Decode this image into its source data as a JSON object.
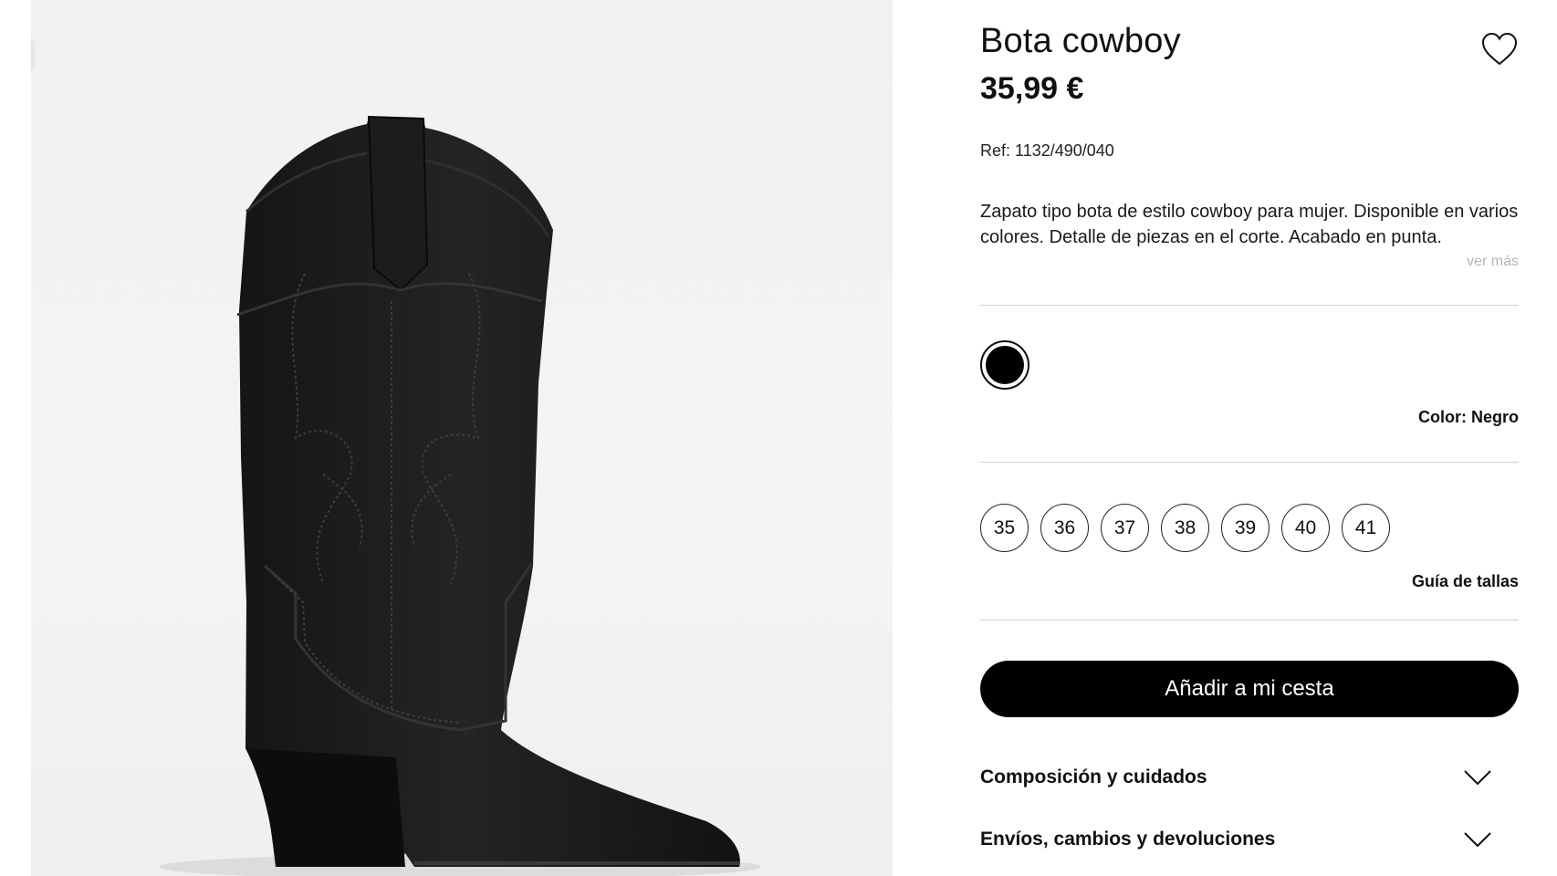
{
  "product": {
    "title": "Bota cowboy",
    "price": "35,99 €",
    "ref": "Ref: 1132/490/040",
    "description": "Zapato tipo bota de estilo cowboy para mujer. Disponible en varios colores. Detalle de piezas en el corte. Acabado en punta.",
    "see_more": "ver más",
    "favorite_icon": "heart-icon"
  },
  "colors": {
    "selected_label": "Color: Negro",
    "swatches": [
      {
        "name": "Negro",
        "hex": "#000000",
        "selected": true
      }
    ]
  },
  "sizes": {
    "options": [
      "35",
      "36",
      "37",
      "38",
      "39",
      "40",
      "41"
    ],
    "guide_label": "Guía de tallas"
  },
  "cart": {
    "button_label": "Añadir a mi cesta"
  },
  "accordions": [
    {
      "label": "Composición y cuidados",
      "icon": "chevron-down-icon"
    },
    {
      "label": "Envíos, cambios y devoluciones",
      "icon": "chevron-down-icon"
    }
  ],
  "theme": {
    "accent": "#000000",
    "divider": "#d3d3d3",
    "muted_text": "#b5b5b5",
    "image_bg": "#f2f2f2"
  }
}
